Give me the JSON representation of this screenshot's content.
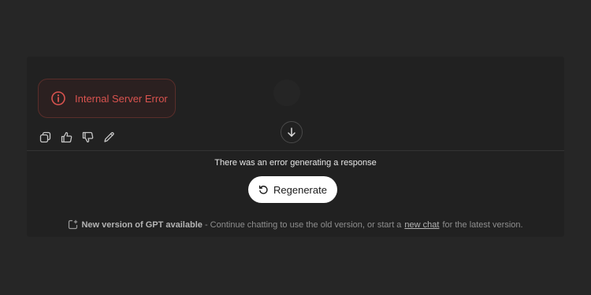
{
  "error": {
    "icon": "info-circle-icon",
    "message": "Internal Server Error",
    "color": "#d9534f"
  },
  "actions": [
    {
      "name": "copy-button",
      "icon": "copy-icon"
    },
    {
      "name": "thumbs-up-button",
      "icon": "thumbs-up-icon"
    },
    {
      "name": "thumbs-down-button",
      "icon": "thumbs-down-icon"
    },
    {
      "name": "edit-button",
      "icon": "pencil-icon"
    }
  ],
  "scroll": {
    "icon": "arrow-down-icon"
  },
  "status": {
    "error_text": "There was an error generating a response"
  },
  "regenerate": {
    "label": "Regenerate",
    "icon": "refresh-icon"
  },
  "footer": {
    "icon": "new-chat-icon",
    "bold_text": "New version of GPT available",
    "middle_text": " - Continue chatting to use the old version, or start a",
    "link_text": "new chat",
    "tail_text": "for the latest version."
  },
  "colors": {
    "background": "#262626",
    "panel": "#212121",
    "button_bg": "#ffffff"
  }
}
